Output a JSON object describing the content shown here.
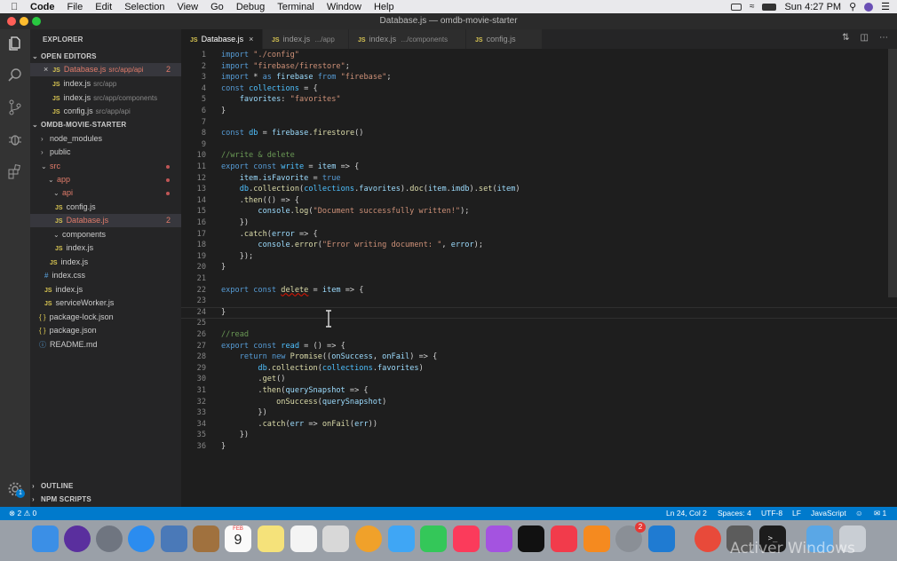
{
  "menubar": {
    "app": "Code",
    "menus": [
      "File",
      "Edit",
      "Selection",
      "View",
      "Go",
      "Debug",
      "Terminal",
      "Window",
      "Help"
    ],
    "clock": "Sun 4:27 PM"
  },
  "window": {
    "title": "Database.js — omdb-movie-starter"
  },
  "explorer": {
    "title": "EXPLORER",
    "open_editors_label": "OPEN EDITORS",
    "open_editors": [
      {
        "name": "Database.js",
        "path": "src/app/api",
        "badge": "2"
      },
      {
        "name": "index.js",
        "path": "src/app"
      },
      {
        "name": "index.js",
        "path": "src/app/components"
      },
      {
        "name": "config.js",
        "path": "src/app/api"
      }
    ],
    "project_label": "OMDB-MOVIE-STARTER",
    "tree": [
      {
        "name": "node_modules"
      },
      {
        "name": "public"
      },
      {
        "name": "src"
      },
      {
        "name": "app"
      },
      {
        "name": "api"
      },
      {
        "name": "config.js"
      },
      {
        "name": "Database.js",
        "badge": "2"
      },
      {
        "name": "components"
      },
      {
        "name": "index.js"
      },
      {
        "name": "index.js"
      },
      {
        "name": "index.css"
      },
      {
        "name": "index.js"
      },
      {
        "name": "serviceWorker.js"
      },
      {
        "name": "package-lock.json"
      },
      {
        "name": "package.json"
      },
      {
        "name": "README.md"
      }
    ],
    "outline_label": "OUTLINE",
    "npm_label": "NPM SCRIPTS"
  },
  "tabs": [
    {
      "name": "Database.js",
      "path": ""
    },
    {
      "name": "index.js",
      "path": ".../app"
    },
    {
      "name": "index.js",
      "path": ".../components"
    },
    {
      "name": "config.js",
      "path": ""
    }
  ],
  "code_lines": [
    "import \"./config\"",
    "import \"firebase/firestore\";",
    "import * as firebase from \"firebase\";",
    "const collections = {",
    "    favorites: \"favorites\"",
    "}",
    "",
    "const db = firebase.firestore()",
    "",
    "//write & delete",
    "export const write = item => {",
    "    item.isFavorite = true",
    "    db.collection(collections.favorites).doc(item.imdb).set(item)",
    "    .then(() => {",
    "        console.log(\"Document successfully written!\");",
    "    })",
    "    .catch(error => {",
    "        console.error(\"Error writing document: \", error);",
    "    });",
    "}",
    "",
    "export const delete = item => {",
    "",
    "}",
    "",
    "//read",
    "export const read = () => {",
    "    return new Promise((onSuccess, onFail) => {",
    "        db.collection(collections.favorites)",
    "        .get()",
    "        .then(querySnapshot => {",
    "            onSuccess(querySnapshot)",
    "        })",
    "        .catch(err => onFail(err))",
    "    })",
    "}"
  ],
  "status": {
    "problems": "⊗ 2 ⚠ 0",
    "position": "Ln 24, Col 2",
    "spaces": "Spaces: 4",
    "encoding": "UTF-8",
    "eol": "LF",
    "language": "JavaScript",
    "notifications": "1"
  },
  "dock": {
    "calendar_month": "FEB",
    "calendar_day": "9",
    "badge_settings": "2",
    "watermark": "Activer Windows"
  },
  "activity_badge": "1"
}
